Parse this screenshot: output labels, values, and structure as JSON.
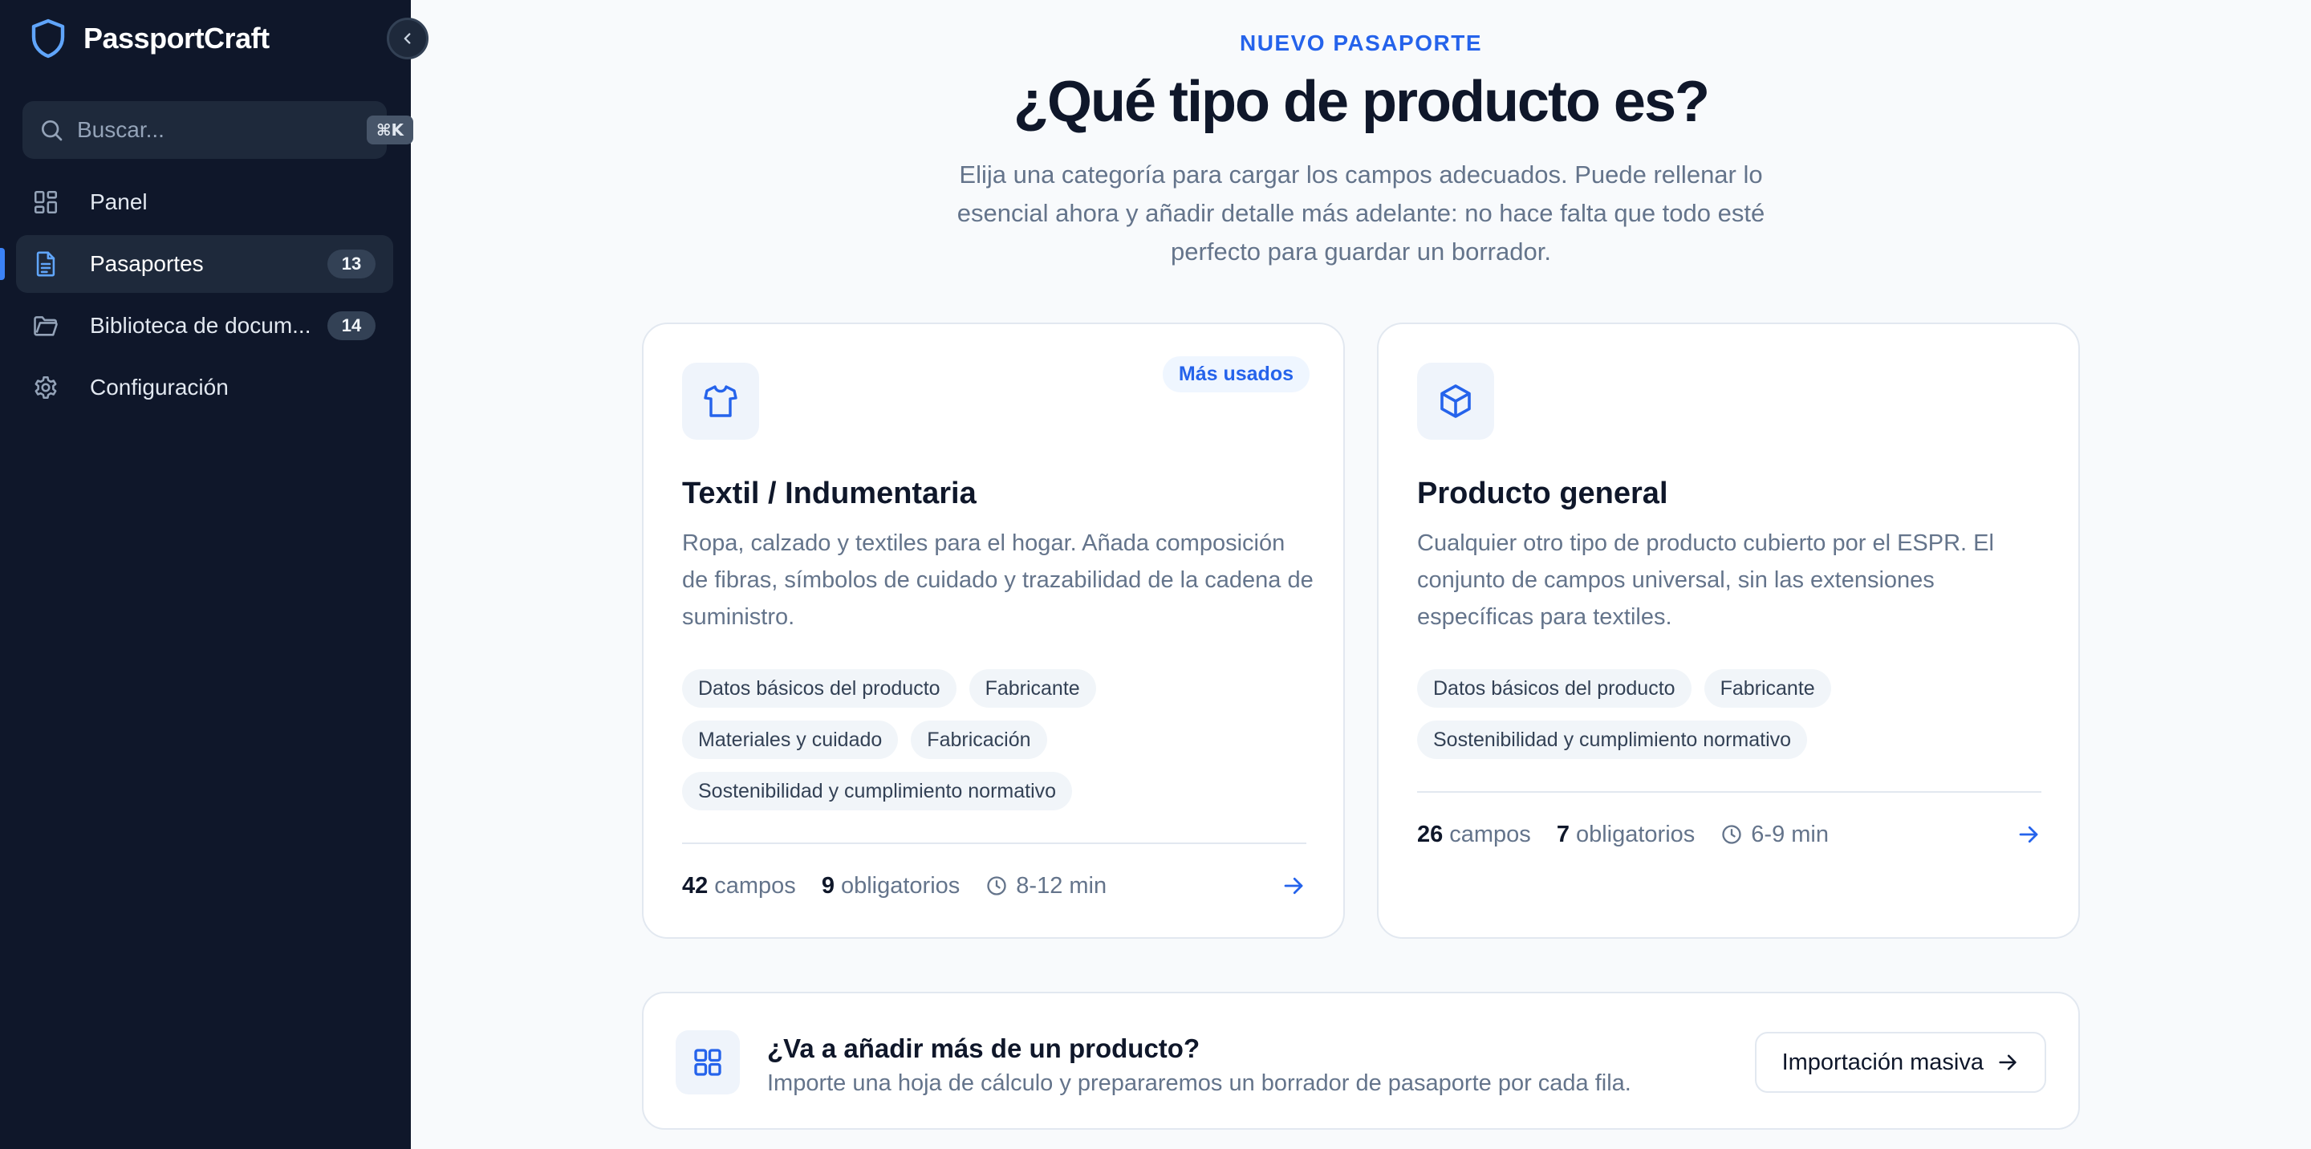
{
  "app": {
    "name": "PassportCraft"
  },
  "sidebar": {
    "search": {
      "placeholder": "Buscar...",
      "shortcut": "⌘K"
    },
    "items": [
      {
        "label": "Panel",
        "icon": "grid-icon"
      },
      {
        "label": "Pasaportes",
        "icon": "document-icon",
        "count": "13",
        "active": true
      },
      {
        "label": "Biblioteca de docum...",
        "icon": "folder-icon",
        "count": "14"
      },
      {
        "label": "Configuración",
        "icon": "gear-icon"
      }
    ]
  },
  "main": {
    "eyebrow": "NUEVO PASAPORTE",
    "title": "¿Qué tipo de producto es?",
    "subtitle": "Elija una categoría para cargar los campos adecuados. Puede rellenar lo esencial ahora y añadir detalle más adelante: no hace falta que todo esté perfecto para guardar un borrador.",
    "cards": [
      {
        "icon": "shirt-icon",
        "badge": "Más usados",
        "title": "Textil / Indumentaria",
        "description": "Ropa, calzado y textiles para el hogar. Añada composición de fibras, símbolos de cuidado y trazabilidad de la cadena de suministro.",
        "chips": [
          "Datos básicos del producto",
          "Fabricante",
          "Materiales y cuidado",
          "Fabricación",
          "Sostenibilidad y cumplimiento normativo"
        ],
        "fields": "42",
        "fields_label": "campos",
        "required": "9",
        "required_label": "obligatorios",
        "time": "8-12 min"
      },
      {
        "icon": "box-icon",
        "title": "Producto general",
        "description": "Cualquier otro tipo de producto cubierto por el ESPR. El conjunto de campos universal, sin las extensiones específicas para textiles.",
        "chips": [
          "Datos básicos del producto",
          "Fabricante",
          "Sostenibilidad y cumplimiento normativo"
        ],
        "fields": "26",
        "fields_label": "campos",
        "required": "7",
        "required_label": "obligatorios",
        "time": "6-9 min"
      }
    ],
    "bulk": {
      "icon": "grid-icon",
      "title": "¿Va a añadir más de un producto?",
      "description": "Importe una hoja de cálculo y prepararemos un borrador de pasaporte por cada fila.",
      "button": "Importación masiva"
    }
  },
  "colors": {
    "sidebar_bg": "#0f172a",
    "accent": "#2563eb",
    "page_bg": "#f8fafc"
  }
}
